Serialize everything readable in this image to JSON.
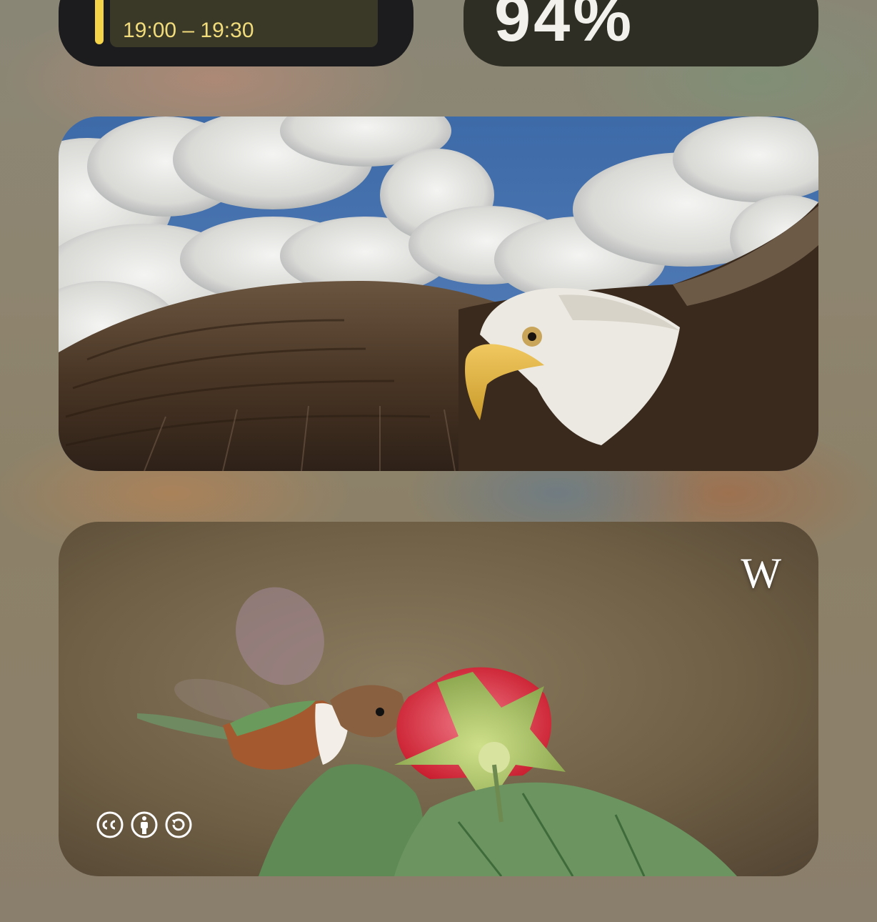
{
  "calendar_widget": {
    "event_time": "19:00 – 19:30",
    "accent_color": "#f5d44a"
  },
  "battery_widget": {
    "percentage": "94%"
  },
  "photo_widget": {
    "subject": "bald eagle in flight against cloudy blue sky"
  },
  "wikipedia_widget": {
    "logo_text": "W",
    "subject": "hummingbird feeding on red flower",
    "license_icons": [
      "cc-icon",
      "by-attribution-icon",
      "share-alike-icon"
    ]
  }
}
